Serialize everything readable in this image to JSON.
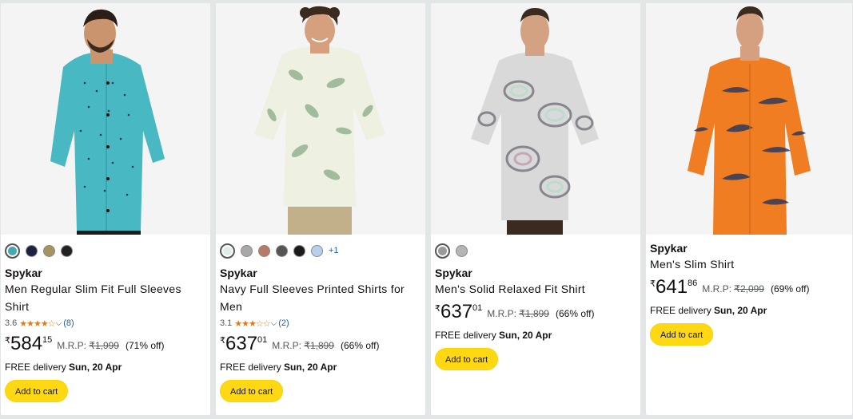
{
  "products": [
    {
      "image_label": "man in turquoise polka dot full sleeve shirt",
      "colors": [
        "#4aa6b0",
        "#1e2240",
        "#a89260",
        "#222222"
      ],
      "more_colors": "",
      "brand": "Spykar",
      "title": "Men Regular Slim Fit Full Sleeves Shirt",
      "rating": "3.6",
      "stars": "★★★★☆",
      "rating_count": "(8)",
      "currency": "₹",
      "price_whole": "584",
      "price_fraction": "15",
      "mrp_label": "M.R.P:",
      "mrp": "₹1,999",
      "discount": "(71% off)",
      "delivery_prefix": "FREE delivery",
      "delivery_date": "Sun, 20 Apr",
      "cart_label": "Add to cart"
    },
    {
      "image_label": "man in cream leaf print half sleeve shirt",
      "colors": [
        "#dfeee4",
        "#a8a8a8",
        "#b77a66",
        "#555555",
        "#1b1b1b",
        "#b8d0ea"
      ],
      "more_colors": "+1",
      "brand": "Spykar",
      "title": "Navy Full Sleeves Printed Shirts for Men",
      "rating": "3.1",
      "stars": "★★★☆☆",
      "rating_count": "(2)",
      "currency": "₹",
      "price_whole": "637",
      "price_fraction": "01",
      "mrp_label": "M.R.P:",
      "mrp": "₹1,899",
      "discount": "(66% off)",
      "delivery_prefix": "FREE delivery",
      "delivery_date": "Sun, 20 Apr",
      "cart_label": "Add to cart"
    },
    {
      "image_label": "man in grey abstract print half sleeve shirt",
      "colors": [
        "#9a9a9a",
        "#b5b5b5"
      ],
      "more_colors": "",
      "brand": "Spykar",
      "title": "Men's Solid Relaxed Fit Shirt",
      "rating": "",
      "stars": "",
      "rating_count": "",
      "currency": "₹",
      "price_whole": "637",
      "price_fraction": "01",
      "mrp_label": "M.R.P:",
      "mrp": "₹1,899",
      "discount": "(66% off)",
      "delivery_prefix": "FREE delivery",
      "delivery_date": "Sun, 20 Apr",
      "cart_label": "Add to cart"
    },
    {
      "image_label": "man in orange printed full sleeve shirt",
      "colors": [],
      "more_colors": "",
      "brand": "Spykar",
      "title": "Men's Slim Shirt",
      "rating": "",
      "stars": "",
      "rating_count": "",
      "currency": "₹",
      "price_whole": "641",
      "price_fraction": "86",
      "mrp_label": "M.R.P:",
      "mrp": "₹2,099",
      "discount": "(69% off)",
      "delivery_prefix": "FREE delivery",
      "delivery_date": "Sun, 20 Apr",
      "cart_label": "Add to cart"
    }
  ]
}
